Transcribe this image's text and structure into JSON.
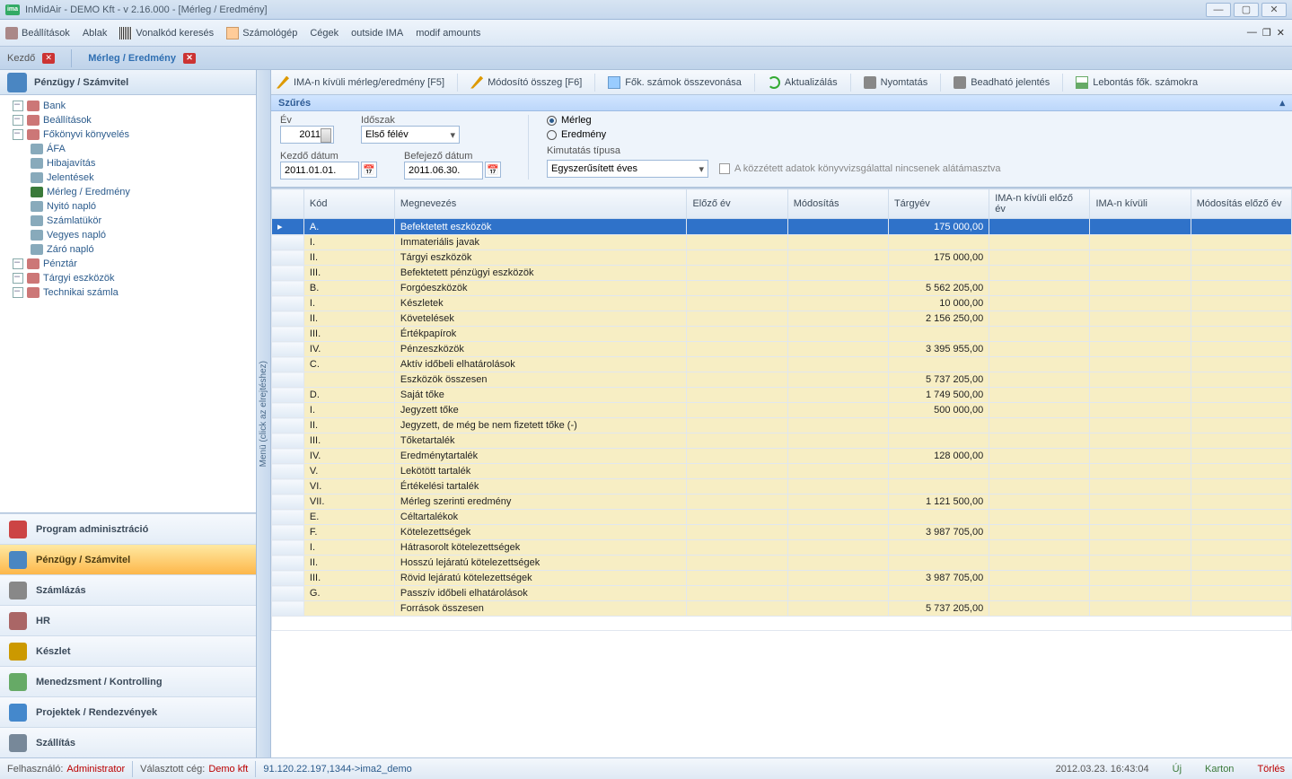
{
  "window": {
    "title": "InMidAir - DEMO Kft - v 2.16.000 - [Mérleg / Eredmény]",
    "app_abbr": "ima"
  },
  "menu": {
    "settings": "Beállítások",
    "window": "Ablak",
    "barcode": "Vonalkód keresés",
    "calculator": "Számológép",
    "cegek": "Cégek",
    "outside": "outside IMA",
    "modif": "modif amounts"
  },
  "tabs": {
    "home": "Kezdő",
    "active": "Mérleg / Eredmény"
  },
  "left": {
    "header": "Pénzügy / Számvitel",
    "tree": [
      {
        "label": "Bank",
        "lvl": 1,
        "icn": "#c77"
      },
      {
        "label": "Beállítások",
        "lvl": 1,
        "icn": "#c77"
      },
      {
        "label": "Főkönyvi könyvelés",
        "lvl": 1,
        "exp": true,
        "icn": "#c77"
      },
      {
        "label": "ÁFA",
        "lvl": 2,
        "icn": "#8ab"
      },
      {
        "label": "Hibajavítás",
        "lvl": 2,
        "icn": "#8ab"
      },
      {
        "label": "Jelentések",
        "lvl": 2,
        "icn": "#8ab"
      },
      {
        "label": "Mérleg / Eredmény",
        "lvl": 2,
        "sel": true,
        "icn": "#3a7a3a"
      },
      {
        "label": "Nyitó napló",
        "lvl": 2,
        "icn": "#8ab"
      },
      {
        "label": "Számlatükör",
        "lvl": 2,
        "icn": "#8ab"
      },
      {
        "label": "Vegyes napló",
        "lvl": 2,
        "icn": "#8ab"
      },
      {
        "label": "Záró napló",
        "lvl": 2,
        "icn": "#8ab"
      },
      {
        "label": "Pénztár",
        "lvl": 1,
        "icn": "#c77"
      },
      {
        "label": "Tárgyi eszközök",
        "lvl": 1,
        "icn": "#c77"
      },
      {
        "label": "Technikai számla",
        "lvl": 1,
        "icn": "#c77"
      }
    ],
    "big": [
      {
        "label": "Program adminisztráció",
        "icn": "#c44"
      },
      {
        "label": "Pénzügy / Számvitel",
        "icn": "#4a86c2",
        "sel": true
      },
      {
        "label": "Számlázás",
        "icn": "#888"
      },
      {
        "label": "HR",
        "icn": "#a66"
      },
      {
        "label": "Készlet",
        "icn": "#c90"
      },
      {
        "label": "Menedzsment / Kontrolling",
        "icn": "#6a6"
      },
      {
        "label": "Projektek / Rendezvények",
        "icn": "#48c"
      },
      {
        "label": "Szállítás",
        "icn": "#789"
      }
    ]
  },
  "collapser_text": "Menü (click az elrejtéshez)",
  "toolbar": {
    "b1": "IMA-n kívüli mérleg/eredmény [F5]",
    "b2": "Módosító összeg [F6]",
    "b3": "Fők. számok összevonása",
    "b4": "Aktualizálás",
    "b5": "Nyomtatás",
    "b6": "Beadható jelentés",
    "b7": "Lebontás fők. számokra"
  },
  "filter": {
    "title": "Szűrés",
    "year_lbl": "Év",
    "year": "2011",
    "period_lbl": "Időszak",
    "period": "Első félév",
    "start_lbl": "Kezdő dátum",
    "start": "2011.01.01.",
    "end_lbl": "Befejező dátum",
    "end": "2011.06.30.",
    "r1": "Mérleg",
    "r2": "Eredmény",
    "type_lbl": "Kimutatás típusa",
    "type": "Egyszerűsített éves",
    "chk": "A közzétett adatok könyvvizsgálattal nincsenek alátámasztva"
  },
  "grid": {
    "cols": [
      "Kód",
      "Megnevezés",
      "Előző év",
      "Módosítás",
      "Tárgyév",
      "IMA-n kívüli előző év",
      "IMA-n kívüli",
      "Módosítás előző év"
    ],
    "rows": [
      {
        "kod": "A.",
        "meg": "Befektetett eszközök",
        "targy": "175 000,00",
        "sel": true
      },
      {
        "kod": "I.",
        "meg": "Immateriális javak"
      },
      {
        "kod": "II.",
        "meg": "Tárgyi eszközök",
        "targy": "175 000,00"
      },
      {
        "kod": "III.",
        "meg": "Befektetett pénzügyi eszközök"
      },
      {
        "kod": "B.",
        "meg": "Forgóeszközök",
        "targy": "5 562 205,00"
      },
      {
        "kod": "I.",
        "meg": "Készletek",
        "targy": "10 000,00"
      },
      {
        "kod": "II.",
        "meg": "Követelések",
        "targy": "2 156 250,00"
      },
      {
        "kod": "III.",
        "meg": "Értékpapírok"
      },
      {
        "kod": "IV.",
        "meg": "Pénzeszközök",
        "targy": "3 395 955,00"
      },
      {
        "kod": "C.",
        "meg": "Aktív időbeli elhatárolások"
      },
      {
        "kod": "",
        "meg": "Eszközök összesen",
        "targy": "5 737 205,00"
      },
      {
        "kod": "D.",
        "meg": "Saját tőke",
        "targy": "1 749 500,00"
      },
      {
        "kod": "I.",
        "meg": "Jegyzett tőke",
        "targy": "500 000,00"
      },
      {
        "kod": "II.",
        "meg": "Jegyzett, de még be nem fizetett tőke (-)"
      },
      {
        "kod": "III.",
        "meg": "Tőketartalék"
      },
      {
        "kod": "IV.",
        "meg": "Eredménytartalék",
        "targy": "128 000,00"
      },
      {
        "kod": "V.",
        "meg": "Lekötött tartalék"
      },
      {
        "kod": "VI.",
        "meg": "Értékelési tartalék"
      },
      {
        "kod": "VII.",
        "meg": "Mérleg szerinti eredmény",
        "targy": "1 121 500,00"
      },
      {
        "kod": "E.",
        "meg": "Céltartalékok"
      },
      {
        "kod": "F.",
        "meg": "Kötelezettségek",
        "targy": "3 987 705,00"
      },
      {
        "kod": "I.",
        "meg": "Hátrasorolt kötelezettségek"
      },
      {
        "kod": "II.",
        "meg": "Hosszú lejáratú kötelezettségek"
      },
      {
        "kod": "III.",
        "meg": "Rövid lejáratú kötelezettségek",
        "targy": "3 987 705,00"
      },
      {
        "kod": "G.",
        "meg": "Passzív időbeli elhatárolások"
      },
      {
        "kod": "",
        "meg": "Források összesen",
        "targy": "5 737 205,00"
      }
    ]
  },
  "status": {
    "user_lbl": "Felhasználó:",
    "user": "Administrator",
    "ceg_lbl": "Választott cég:",
    "ceg": "Demo kft",
    "conn": "91.120.22.197,1344->ima2_demo",
    "time": "2012.03.23. 16:43:04",
    "uj": "Új",
    "karton": "Karton",
    "torles": "Törlés"
  }
}
